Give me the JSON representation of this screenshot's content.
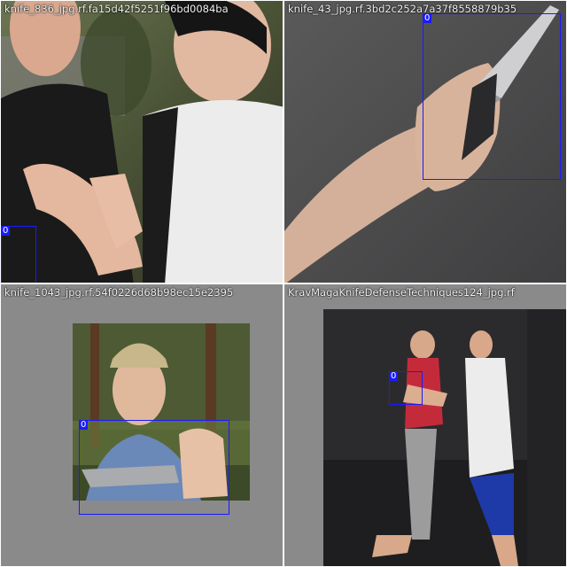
{
  "tiles": [
    {
      "label": "knife_836_jpg.rf.fa15d42f5251f96bd0084ba",
      "boxes": [
        {
          "class_id": "0"
        }
      ]
    },
    {
      "label": "knife_43_jpg.rf.3bd2c252a7a37f8558879b35",
      "boxes": [
        {
          "class_id": "0"
        }
      ]
    },
    {
      "label": "knife_1043_jpg.rf.54f0226d68b98ec15e2395",
      "boxes": [
        {
          "class_id": "0"
        }
      ]
    },
    {
      "label": "KravMagaKnifeDefenseTechniques124_jpg.rf",
      "boxes": [
        {
          "class_id": "0"
        }
      ]
    }
  ],
  "colors": {
    "box": "#1a1aff",
    "padding_gray": "#8a8a8a"
  }
}
